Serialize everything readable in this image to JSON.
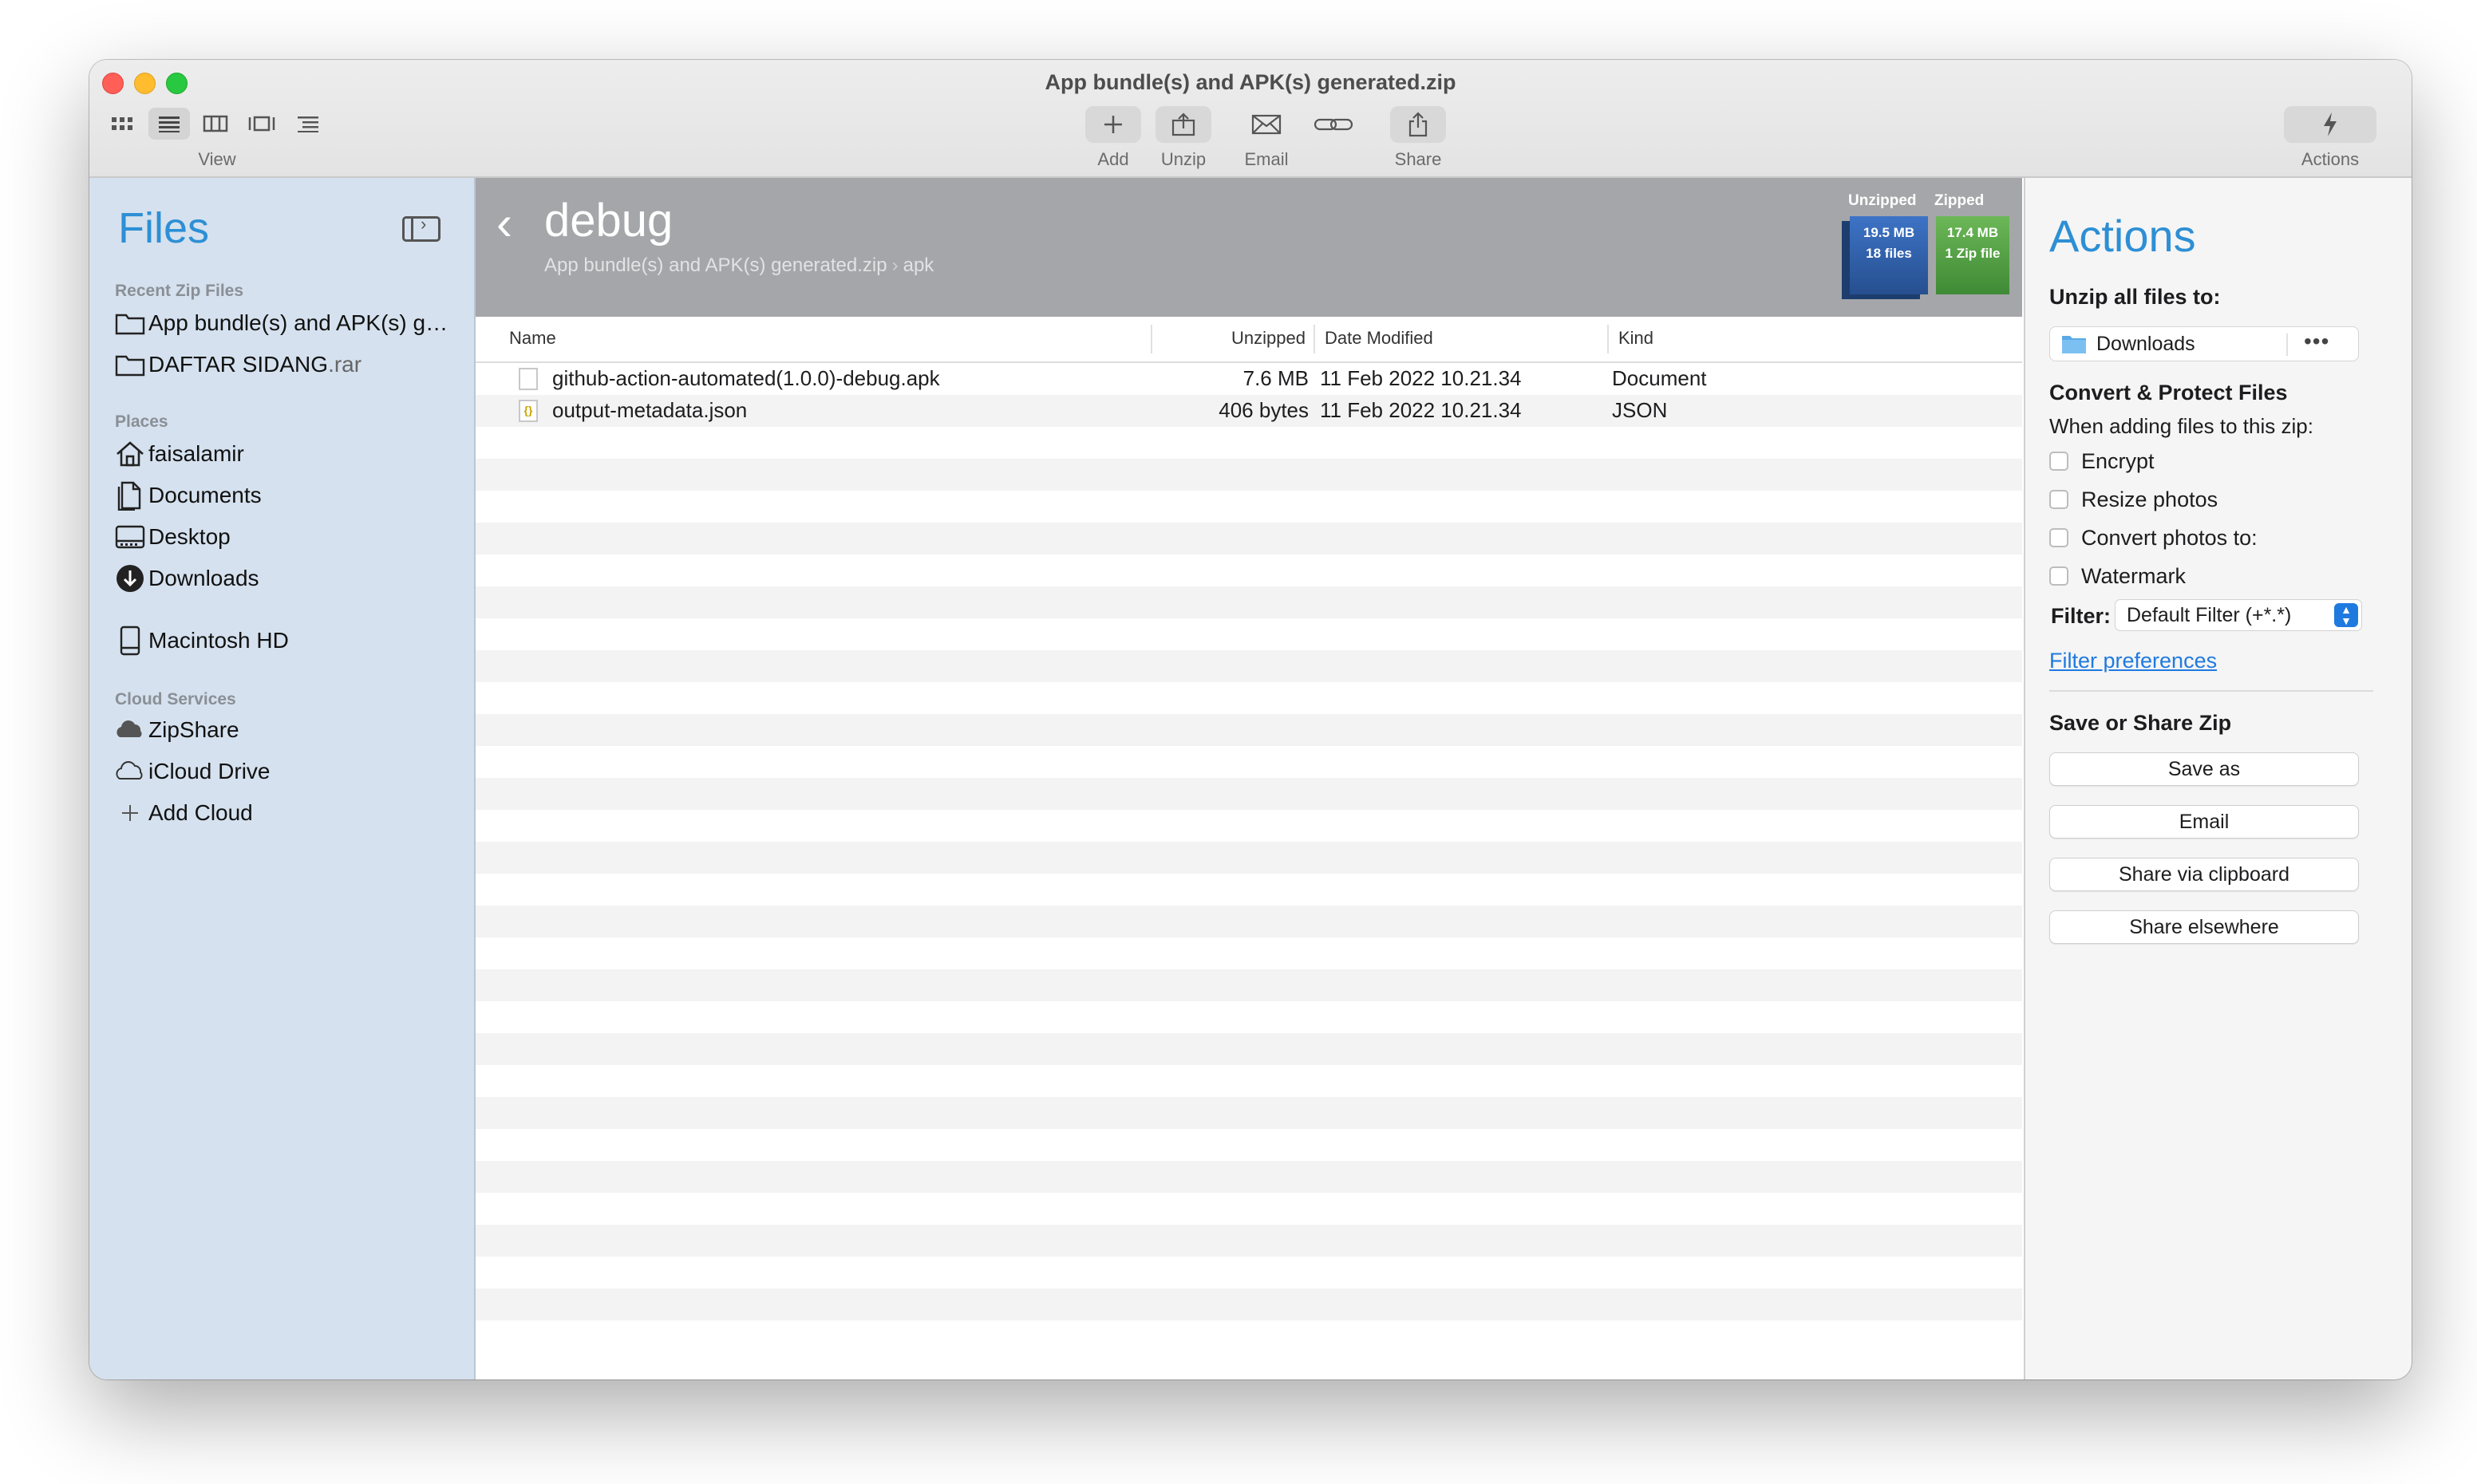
{
  "window": {
    "title": "App bundle(s) and APK(s) generated.zip"
  },
  "toolbar": {
    "view_label": "View",
    "view_modes": [
      "icon-grid-icon",
      "list-view-icon",
      "column-view-icon",
      "gallery-view-icon",
      "outline-view-icon"
    ],
    "add_label": "Add",
    "unzip_label": "Unzip",
    "email_label": "Email",
    "share_label": "Share",
    "actions_label": "Actions"
  },
  "sidebar": {
    "title": "Files",
    "recent_heading": "Recent Zip Files",
    "recent": [
      {
        "label": "App bundle(s) and APK(s) g…",
        "ext": ""
      },
      {
        "label": "DAFTAR SIDANG",
        "ext": ".rar"
      }
    ],
    "places_heading": "Places",
    "places": [
      {
        "label": "faisalamir",
        "icon": "home-icon"
      },
      {
        "label": "Documents",
        "icon": "documents-icon"
      },
      {
        "label": "Desktop",
        "icon": "desktop-icon"
      },
      {
        "label": "Downloads",
        "icon": "downloads-icon"
      },
      {
        "label": "Macintosh HD",
        "icon": "hard-drive-icon"
      }
    ],
    "cloud_heading": "Cloud Services",
    "cloud": [
      {
        "label": "ZipShare",
        "icon": "zipshare-cloud-icon"
      },
      {
        "label": "iCloud Drive",
        "icon": "icloud-icon"
      },
      {
        "label": "Add Cloud",
        "icon": "plus-icon"
      }
    ]
  },
  "browser": {
    "folder_name": "debug",
    "breadcrumb": [
      "App bundle(s) and APK(s) generated.zip",
      "apk"
    ],
    "stats": {
      "unzipped_label": "Unzipped",
      "zipped_label": "Zipped",
      "unzipped_size": "19.5 MB",
      "unzipped_count": "18 files",
      "zipped_size": "17.4 MB",
      "zipped_count": "1 Zip file"
    },
    "columns": [
      "Name",
      "Unzipped",
      "Date Modified",
      "Kind"
    ],
    "files": [
      {
        "name": "github-action-automated(1.0.0)-debug.apk",
        "size": "7.6 MB",
        "date": "11 Feb 2022 10.21.34",
        "kind": "Document",
        "icon": "document-file-icon"
      },
      {
        "name": "output-metadata.json",
        "size": "406 bytes",
        "date": "11 Feb 2022 10.21.34",
        "kind": "JSON",
        "icon": "json-file-icon"
      }
    ]
  },
  "actions": {
    "title": "Actions",
    "unzip_heading": "Unzip all files to:",
    "destination": "Downloads",
    "convert_heading": "Convert & Protect Files",
    "convert_sub": "When adding files to this zip:",
    "options": [
      {
        "label": "Encrypt",
        "checked": false
      },
      {
        "label": "Resize photos",
        "checked": false
      },
      {
        "label": "Convert photos to:",
        "checked": false
      },
      {
        "label": "Watermark",
        "checked": false
      }
    ],
    "filter_label": "Filter:",
    "filter_value": "Default Filter (+*.*)",
    "filter_link": "Filter preferences",
    "save_heading": "Save or Share Zip",
    "buttons": [
      "Save as",
      "Email",
      "Share via clipboard",
      "Share elsewhere"
    ]
  },
  "colors": {
    "accent": "#2d8fd5",
    "link": "#1f7ae0",
    "sidebar_bg": "#d5e1ee",
    "header_bg": "#a5a6aa"
  }
}
